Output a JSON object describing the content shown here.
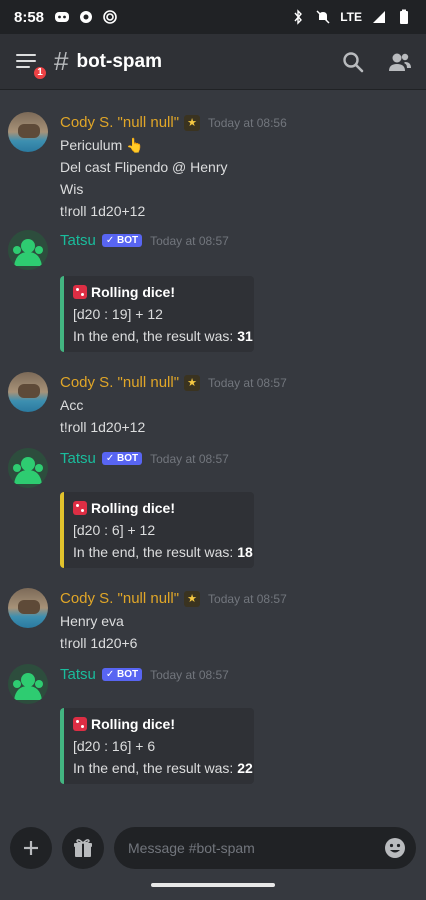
{
  "status_bar": {
    "time": "8:58",
    "network": "LTE"
  },
  "header": {
    "hash": "#",
    "channel": "bot-spam",
    "notification_count": "1"
  },
  "messages": [
    {
      "author": "Cody S. \"null null\"",
      "timestamp": "Today at 08:56",
      "lines": [
        "Periculum 👆",
        "Del cast Flipendo @ Henry",
        "Wis",
        "t!roll 1d20+12"
      ]
    },
    {
      "author": "Tatsu",
      "bot_tag": "✓ BOT",
      "timestamp": "Today at 08:57",
      "embed": {
        "color": "#43b581",
        "title": "Rolling dice!",
        "roll": "[d20 : 19] + 12",
        "result_prefix": "In the end, the result was: ",
        "result": "31"
      }
    },
    {
      "author": "Cody S. \"null null\"",
      "timestamp": "Today at 08:57",
      "lines": [
        "Acc",
        "t!roll 1d20+12"
      ]
    },
    {
      "author": "Tatsu",
      "bot_tag": "✓ BOT",
      "timestamp": "Today at 08:57",
      "embed": {
        "color": "#e1c22c",
        "title": "Rolling dice!",
        "roll": "[d20 : 6] + 12",
        "result_prefix": "In the end, the result was: ",
        "result": "18"
      }
    },
    {
      "author": "Cody S. \"null null\"",
      "timestamp": "Today at 08:57",
      "lines": [
        "Henry eva",
        "t!roll 1d20+6"
      ]
    },
    {
      "author": "Tatsu",
      "bot_tag": "✓ BOT",
      "timestamp": "Today at 08:57",
      "embed": {
        "color": "#43b581",
        "title": "Rolling dice!",
        "roll": "[d20 : 16] + 6",
        "result_prefix": "In the end, the result was: ",
        "result": "22"
      }
    }
  ],
  "composer": {
    "placeholder": "Message #bot-spam"
  },
  "colors": {
    "background": "#36393f",
    "header": "#2f3136",
    "cody_name": "#e0a628",
    "tatsu_name": "#1abc9c",
    "bot_tag": "#5865f2"
  }
}
